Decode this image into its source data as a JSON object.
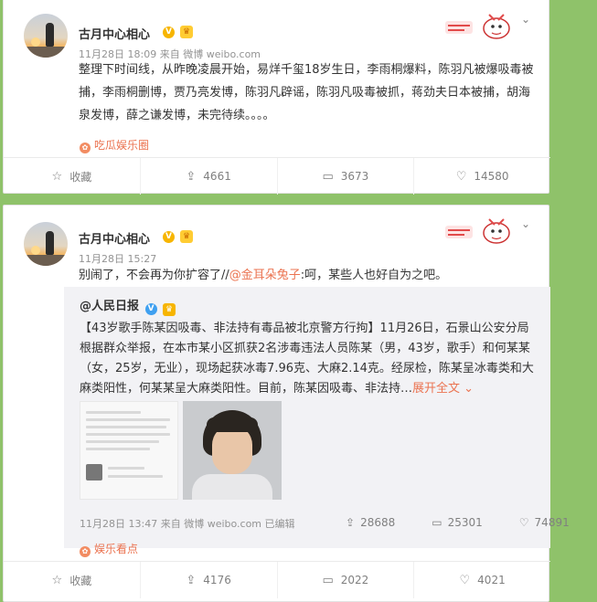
{
  "posts": [
    {
      "username": "古月中心相心",
      "timestamp": "11月28日 18:09",
      "source": "来自 微博 weibo.com",
      "text": "整理下时间线，从昨晚凌晨开始，易烊千玺18岁生日，李雨桐爆料，陈羽凡被爆吸毒被捕，李雨桐删博，贾乃亮发博，陈羽凡辟谣，陈羽凡吸毒被抓，蒋劲夫日本被捕，胡海泉发博，薛之谦发博，未完待续。。。。",
      "topic": "吃瓜娱乐圈",
      "actions": {
        "favorite": "收藏",
        "repost": "4661",
        "comment": "3673",
        "like": "14580"
      }
    },
    {
      "username": "古月中心相心",
      "timestamp": "11月28日 15:27",
      "text_before": "别闹了，不会再为你扩容了//",
      "mention": "@金耳朵兔子",
      "text_after": ":呵，某些人也好自为之吧。",
      "repost": {
        "author": "@人民日报",
        "text": "【43岁歌手陈某因吸毒、非法持有毒品被北京警方行拘】11月26日，石景山公安分局根据群众举报，在本市某小区抓获2名涉毒违法人员陈某（男，43岁，歌手）和何某某（女，25岁，无业），现场起获冰毒7.96克、大麻2.14克。经尿检，陈某呈冰毒类和大麻类阳性，何某某呈大麻类阳性。目前，陈某因吸毒、非法持",
        "expand": "展开全文",
        "timestamp": "11月28日 13:47",
        "source": "来自 微博 weibo.com",
        "edited": "已编辑",
        "reposts": "28688",
        "comments": "25301",
        "likes": "74891"
      },
      "topic": "娱乐看点",
      "actions": {
        "favorite": "收藏",
        "repost": "4176",
        "comment": "2022",
        "like": "4021"
      }
    }
  ],
  "icons": {
    "verified": "v-badge-icon",
    "vip": "vip-crown-icon",
    "menu": "chevron-down-icon",
    "repost": "repost-icon",
    "comment": "comment-icon",
    "like": "thumbs-up-icon",
    "favorite": "star-icon"
  },
  "colors": {
    "background": "#8fc26a",
    "accent": "#eb7350",
    "muted": "#939393"
  }
}
